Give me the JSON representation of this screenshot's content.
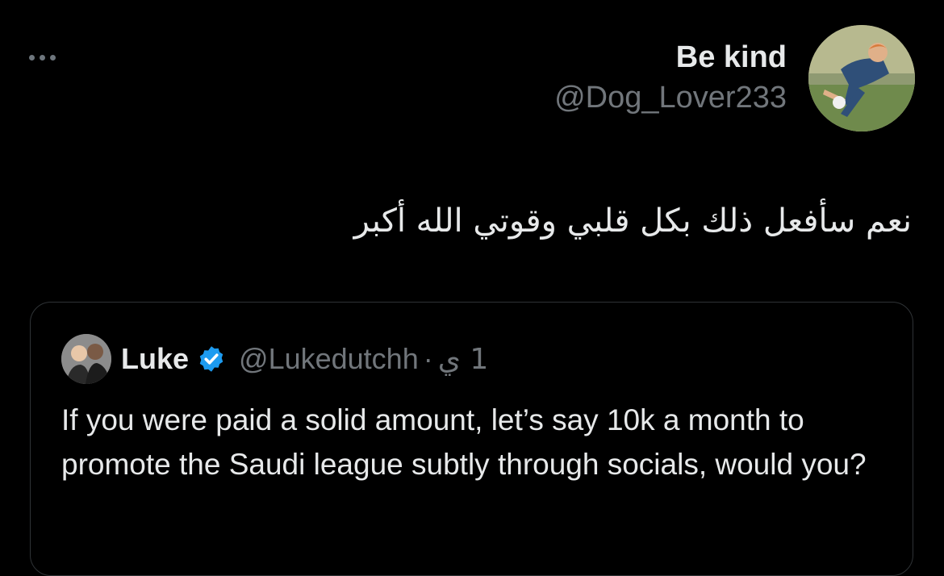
{
  "tweet": {
    "display_name": "Be kind",
    "handle": "@Dog_Lover233",
    "text": "نعم سأفعل ذلك بكل قلبي وقوتي الله أكبر",
    "more_icon": "ellipsis-icon"
  },
  "quoted_tweet": {
    "display_name": "Luke",
    "verified_icon": "verified-badge-icon",
    "verified_color": "#1d9bf0",
    "handle": "@Lukedutchh",
    "separator": "·",
    "time": "1 ي",
    "text": "If you were paid a solid amount, let’s say 10k a month to promote the Saudi league subtly through socials, would you?"
  },
  "colors": {
    "background": "#000000",
    "primary_text": "#e7e9ea",
    "secondary_text": "#71767b",
    "border": "#2f3336"
  }
}
